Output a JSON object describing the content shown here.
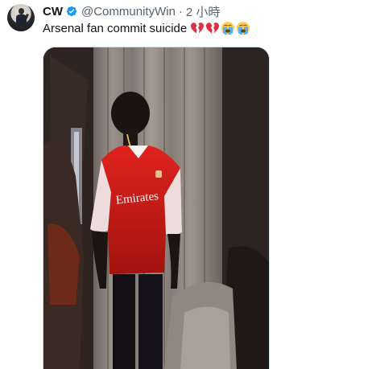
{
  "author": {
    "display_name": "CW",
    "handle": "@CommunityWin",
    "separator": "·",
    "timestamp": "2 小時",
    "verified": true,
    "avatar_icon": "avatar-photo"
  },
  "tweet": {
    "text": "Arsenal fan commit suicide",
    "emojis": [
      "broken-heart-icon",
      "broken-heart-icon",
      "loudly-crying-face-icon",
      "loudly-crying-face-icon"
    ]
  },
  "media": {
    "type": "video",
    "shirt_text": "Emirates",
    "accent_color": "#d0201c",
    "verified_color": "#1d9bf0"
  }
}
